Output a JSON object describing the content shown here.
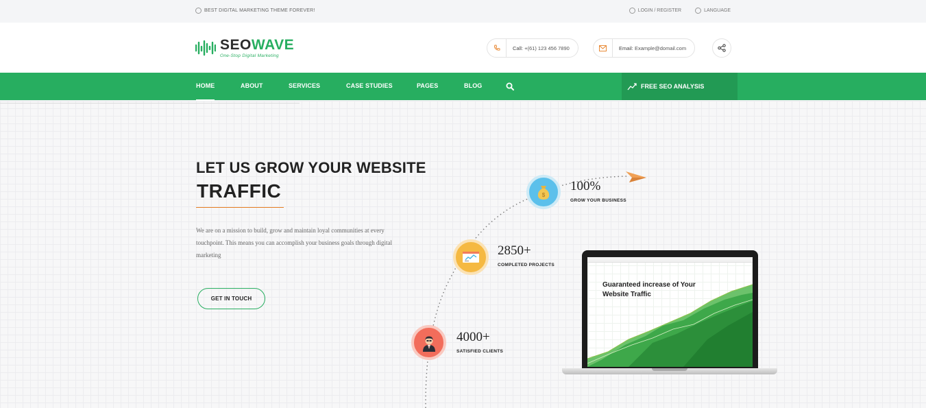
{
  "topbar": {
    "tagline": "BEST DIGITAL MARKETING THEME FOREVER!",
    "login": "LOGIN / REGISTER",
    "language": "LANGUAGE"
  },
  "header": {
    "logo_seo": "SEO",
    "logo_wave": "WAVE",
    "logo_sub": "One-Stop Digital Marketing",
    "call_label": "Call:",
    "call_value": "+(61) 123 456 7890",
    "email_label": "Email:",
    "email_value": "Example@domail.com"
  },
  "nav": {
    "items": [
      "HOME",
      "ABOUT",
      "SERVICES",
      "CASE STUDIES",
      "PAGES",
      "BLOG"
    ],
    "active": "HOME",
    "cta": "FREE SEO ANALYSIS"
  },
  "hero": {
    "title_line1": "LET US GROW YOUR WEBSITE",
    "title_line2": "TRAFFIC",
    "description": "We are on a mission to build, grow and maintain loyal communities at every touchpoint. This means you can accomplish your business goals through digital marketing",
    "button": "GET IN TOUCH"
  },
  "stats": [
    {
      "value": "100%",
      "label": "GROW YOUR BUSINESS",
      "icon": "money-bag-icon",
      "color": "#5bc0eb"
    },
    {
      "value": "2850+",
      "label": "COMPLETED PROJECTS",
      "icon": "browser-window-icon",
      "color": "#f5b942"
    },
    {
      "value": "4000+",
      "label": "SATISFIED CLIENTS",
      "icon": "businessman-icon",
      "color": "#f26d5b"
    }
  ],
  "laptop": {
    "screen_title": "Guaranteed increase of Your Website Traffic"
  },
  "colors": {
    "brand_green": "#27ae60",
    "accent_orange": "#e67e22"
  }
}
